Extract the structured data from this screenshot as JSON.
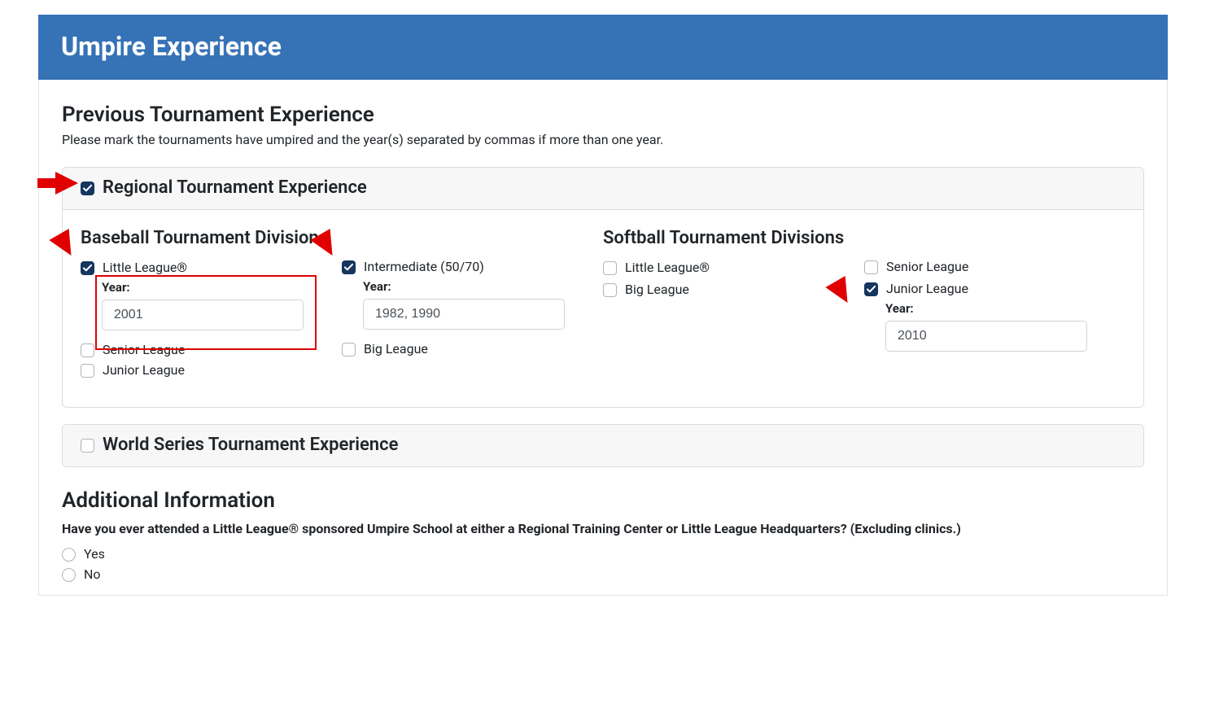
{
  "header": {
    "title": "Umpire Experience"
  },
  "prev_exp": {
    "title": "Previous Tournament Experience",
    "desc": "Please mark the tournaments have umpired and the year(s) separated by commas if more than one year."
  },
  "regional": {
    "heading": "Regional Tournament Experience",
    "baseball_title": "Baseball Tournament Divisions",
    "softball_title": "Softball Tournament Divisions",
    "year_label": "Year:",
    "baseball": {
      "little_league": {
        "label": "Little League®",
        "year": "2001"
      },
      "senior_league": {
        "label": "Senior League"
      },
      "junior_league": {
        "label": "Junior League"
      },
      "intermediate": {
        "label": "Intermediate (50/70)",
        "year": "1982, 1990"
      },
      "big_league": {
        "label": "Big League"
      }
    },
    "softball": {
      "little_league": {
        "label": "Little League®"
      },
      "big_league": {
        "label": "Big League"
      },
      "senior_league": {
        "label": "Senior League"
      },
      "junior_league": {
        "label": "Junior League",
        "year": "2010"
      }
    }
  },
  "world_series": {
    "heading": "World Series Tournament Experience"
  },
  "additional": {
    "title": "Additional Information",
    "question": "Have you ever attended a Little League® sponsored Umpire School at either a Regional Training Center or Little League Headquarters? (Excluding clinics.)",
    "yes": "Yes",
    "no": "No"
  }
}
